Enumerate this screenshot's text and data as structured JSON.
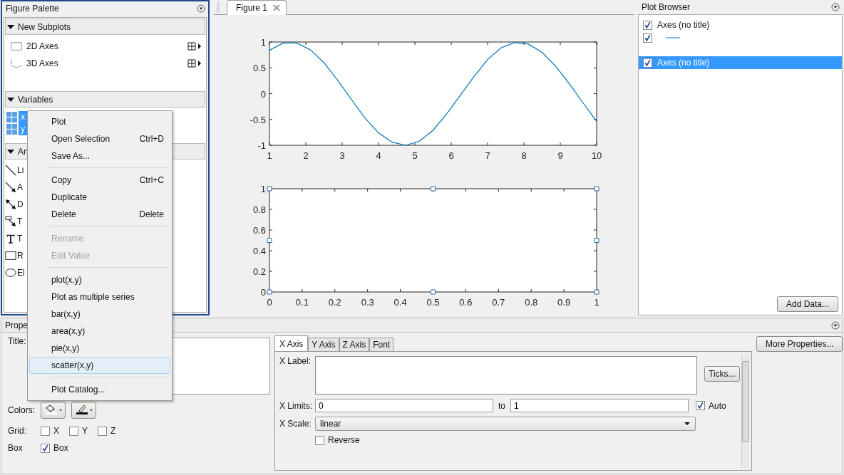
{
  "figure_palette": {
    "title": "Figure Palette",
    "sections": [
      {
        "title": "New Subplots",
        "expanded": true,
        "items": [
          {
            "kind": "axes2d",
            "label": "2D Axes"
          },
          {
            "kind": "axes3d",
            "label": "3D Axes"
          }
        ]
      },
      {
        "title": "Variables",
        "expanded": true,
        "variables": [
          {
            "name": "x",
            "selected": true
          },
          {
            "name": "y",
            "selected": true
          }
        ]
      },
      {
        "title": "An",
        "expanded": true,
        "items": [
          {
            "kind": "line",
            "label": "Li"
          },
          {
            "kind": "arrow",
            "label": "A"
          },
          {
            "kind": "double-arrow",
            "label": "D"
          },
          {
            "kind": "text-arrow",
            "label": "T"
          },
          {
            "kind": "text",
            "label": "T"
          },
          {
            "kind": "rectangle",
            "label": "R"
          },
          {
            "kind": "ellipse",
            "label": "El"
          }
        ]
      }
    ]
  },
  "context_menu": {
    "groups": [
      [
        {
          "label": "Plot",
          "disabled": false,
          "selected": false
        },
        {
          "label": "Open Selection",
          "shortcut": "Ctrl+D",
          "disabled": false,
          "selected": false
        },
        {
          "label": "Save As...",
          "disabled": false,
          "selected": false
        }
      ],
      [
        {
          "label": "Copy",
          "shortcut": "Ctrl+C",
          "disabled": false,
          "selected": false
        },
        {
          "label": "Duplicate",
          "disabled": false,
          "selected": false
        },
        {
          "label": "Delete",
          "shortcut": "Delete",
          "disabled": false,
          "selected": false
        }
      ],
      [
        {
          "label": "Rename",
          "disabled": true,
          "selected": false
        },
        {
          "label": "Edit Value",
          "disabled": true,
          "selected": false
        }
      ],
      [
        {
          "label": "plot(x,y)",
          "disabled": false,
          "selected": false
        },
        {
          "label": "Plot as multiple series",
          "disabled": false,
          "selected": false
        },
        {
          "label": "bar(x,y)",
          "disabled": false,
          "selected": false
        },
        {
          "label": "area(x,y)",
          "disabled": false,
          "selected": false
        },
        {
          "label": "pie(x,y)",
          "disabled": false,
          "selected": false
        },
        {
          "label": "scatter(x,y)",
          "disabled": false,
          "selected": true
        }
      ],
      [
        {
          "label": "Plot Catalog...",
          "disabled": false,
          "selected": false
        }
      ]
    ]
  },
  "figure": {
    "tabs": [
      {
        "label": "Figure 1",
        "selected": true
      }
    ],
    "axes": [
      {
        "selected": false,
        "chart_data": {
          "type": "line",
          "x": [
            1,
            1.375,
            1.75,
            2.125,
            2.5,
            2.875,
            3.25,
            3.625,
            4,
            4.375,
            4.75,
            5.125,
            5.5,
            5.875,
            6.25,
            6.625,
            7,
            7.375,
            7.75,
            8.125,
            8.5,
            8.875,
            9.25,
            9.625,
            10
          ],
          "series": [
            {
              "color": "#0072bd",
              "values": [
                0.84,
                0.98,
                0.98,
                0.85,
                0.6,
                0.26,
                -0.11,
                -0.47,
                -0.76,
                -0.94,
                -1,
                -0.92,
                -0.71,
                -0.39,
                -0.03,
                0.33,
                0.66,
                0.89,
                0.99,
                0.96,
                0.8,
                0.53,
                0.19,
                -0.18,
                -0.54
              ]
            }
          ],
          "xlim": [
            1,
            10
          ],
          "ylim": [
            -1,
            1
          ],
          "xticks": [
            1,
            2,
            3,
            4,
            5,
            6,
            7,
            8,
            9,
            10
          ],
          "yticks": [
            -1,
            -0.5,
            0,
            0.5,
            1
          ]
        }
      },
      {
        "selected": true,
        "chart_data": {
          "type": "line",
          "xlim": [
            0,
            1
          ],
          "ylim": [
            0,
            1
          ],
          "xticks": [
            0,
            0.1,
            0.2,
            0.3,
            0.4,
            0.5,
            0.6,
            0.7,
            0.8,
            0.9,
            1
          ],
          "yticks": [
            0,
            0.2,
            0.4,
            0.6,
            0.8,
            1
          ]
        }
      }
    ]
  },
  "plot_browser": {
    "title": "Plot Browser",
    "items": [
      {
        "kind": "axes",
        "label": "Axes (no title)",
        "checked": true,
        "selected": false
      },
      {
        "kind": "line",
        "checked": true,
        "selected": false
      },
      {
        "kind": "axes",
        "label": "Axes (no title)",
        "checked": true,
        "selected": true
      }
    ],
    "add_button": "Add Data..."
  },
  "property_editor": {
    "title": "Prope",
    "title_label": "Title:",
    "colors_label": "Colors:",
    "grid_label": "Grid:",
    "grid": [
      {
        "label": "X",
        "checked": false
      },
      {
        "label": "Y",
        "checked": false
      },
      {
        "label": "Z",
        "checked": false
      }
    ],
    "box_label": "Box",
    "box": {
      "label": "Box",
      "checked": true
    },
    "tabs": [
      {
        "label": "X Axis",
        "selected": true
      },
      {
        "label": "Y Axis",
        "selected": false
      },
      {
        "label": "Z Axis",
        "selected": false
      },
      {
        "label": "Font",
        "selected": false
      }
    ],
    "x_label_label": "X Label:",
    "ticks_button": "Ticks...",
    "x_limits_label": "X Limits:",
    "x_limit_min": "0",
    "to_label": "to",
    "x_limit_max": "1",
    "auto": {
      "label": "Auto",
      "checked": true
    },
    "x_scale_label": "X Scale:",
    "x_scale": "linear",
    "reverse": {
      "label": "Reverse",
      "checked": false
    },
    "more_button": "More Properties..."
  }
}
